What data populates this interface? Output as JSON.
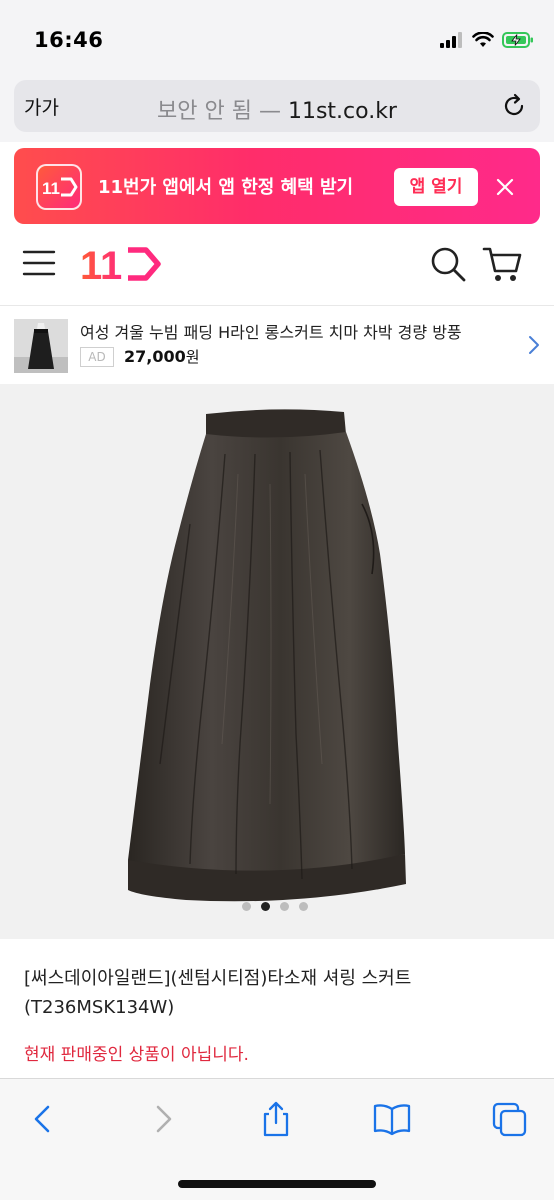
{
  "status": {
    "time": "16:46"
  },
  "urlbar": {
    "aa_label": "가가",
    "insecure_label": "보안 안 됨 — ",
    "domain": "11st.co.kr"
  },
  "banner": {
    "logo_text": "11",
    "text": "11번가 앱에서 앱 한정 혜택 받기",
    "open_button": "앱 열기"
  },
  "header": {
    "logo_text": "11"
  },
  "ad": {
    "title": "여성 겨울 누빔 패딩 H라인 롱스커트 치마 차박 경량 방풍",
    "badge": "AD",
    "price": "27,000",
    "currency": "원"
  },
  "carousel": {
    "count": 4,
    "active_index": 1
  },
  "product": {
    "title": "[써스데이아일랜드](센텀시티점)타소재 셔링 스커트 (T236MSK134W)",
    "status": "현재 판매중인 상품이 아닙니다."
  },
  "colors": {
    "brand": "#ff2d55",
    "status_text": "#e0293f",
    "toolbar_icon": "#1a73e8"
  }
}
